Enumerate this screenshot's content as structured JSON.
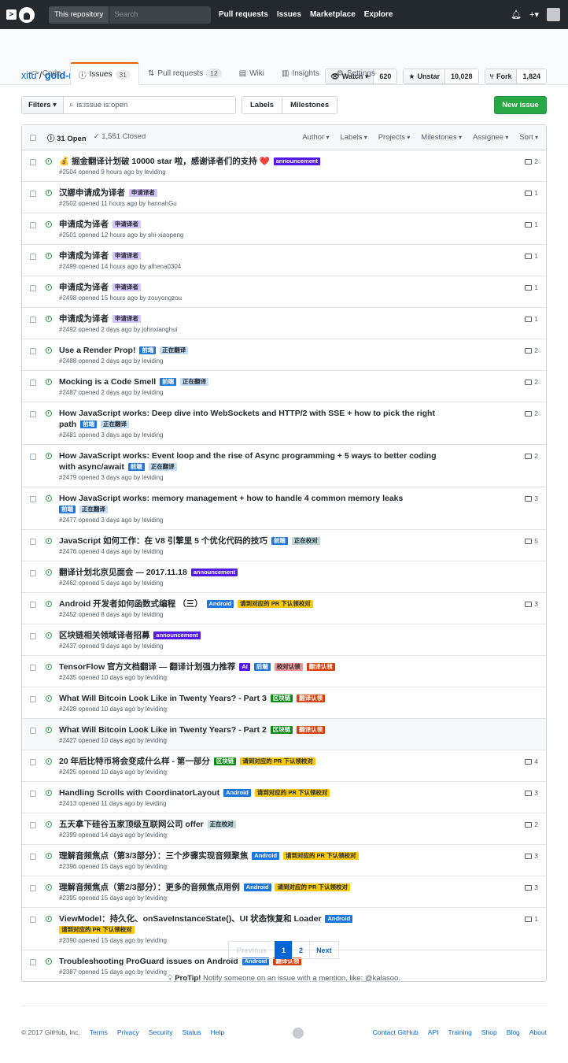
{
  "topbar": {
    "scope": "This repository",
    "search_placeholder": "Search",
    "nav": [
      "Pull requests",
      "Issues",
      "Marketplace",
      "Explore"
    ],
    "plus": "+▾"
  },
  "repo": {
    "owner": "xitu",
    "name": "gold-miner",
    "watch": "Watch ▾",
    "watch_count": "620",
    "unstar": "Unstar",
    "star_count": "10,028",
    "fork": "Fork",
    "fork_count": "1,824"
  },
  "tabs": [
    {
      "label": "Code",
      "icon": "<>"
    },
    {
      "label": "Issues",
      "count": "31"
    },
    {
      "label": "Pull requests",
      "count": "12"
    },
    {
      "label": "Wiki"
    },
    {
      "label": "Insights"
    },
    {
      "label": "Settings"
    }
  ],
  "toolbar": {
    "filters": "Filters ▾",
    "query": "is:issue is:open",
    "labels": "Labels",
    "milestones": "Milestones",
    "new_issue": "New issue"
  },
  "header": {
    "open": "31 Open",
    "closed": "1,551 Closed",
    "filters": [
      "Author",
      "Labels",
      "Projects",
      "Milestones",
      "Assignee",
      "Sort"
    ]
  },
  "label_colors": {
    "announcement": [
      "#5319e7",
      "#fff"
    ],
    "申请译者": [
      "#d4c5f9",
      "#24292e"
    ],
    "前端": [
      "#1d76db",
      "#fff"
    ],
    "正在翻译": [
      "#c5def5",
      "#24292e"
    ],
    "Android": [
      "#1d76db",
      "#fff"
    ],
    "请到对应的 PR 下认领校对": [
      "#fbca04",
      "#24292e"
    ],
    "正在校对": [
      "#bfdadc",
      "#24292e"
    ],
    "AI": [
      "#5319e7",
      "#fff"
    ],
    "后端": [
      "#1d76db",
      "#fff"
    ],
    "校对认领": [
      "#e99695",
      "#24292e"
    ],
    "翻译认领": [
      "#d93f0b",
      "#fff"
    ],
    "区块链": [
      "#0e8a16",
      "#fff"
    ]
  },
  "issues": [
    {
      "title": "💰 掘金翻译计划破 10000 star 啦，感谢译者们的支持 ❤️",
      "labels": [
        "announcement"
      ],
      "meta": "#2504 opened 9 hours ago by leviding",
      "comments": "2"
    },
    {
      "title": "汉娜申请成为译者",
      "labels": [
        "申请译者"
      ],
      "meta": "#2502 opened 11 hours ago by hannahGu",
      "comments": "1"
    },
    {
      "title": "申请成为译者",
      "labels": [
        "申请译者"
      ],
      "meta": "#2501 opened 12 hours ago by shi-xiaopeng",
      "comments": "1"
    },
    {
      "title": "申请成为译者",
      "labels": [
        "申请译者"
      ],
      "meta": "#2499 opened 14 hours ago by athena0304",
      "comments": "1"
    },
    {
      "title": "申请成为译者",
      "labels": [
        "申请译者"
      ],
      "meta": "#2498 opened 15 hours ago by zouyongzou",
      "comments": "1"
    },
    {
      "title": "申请成为译者",
      "labels": [
        "申请译者"
      ],
      "meta": "#2492 opened 2 days ago by johnxianghui",
      "comments": "1"
    },
    {
      "title": "Use a Render Prop!",
      "labels": [
        "前端",
        "正在翻译"
      ],
      "meta": "#2488 opened 2 days ago by leviding",
      "comments": "2"
    },
    {
      "title": "Mocking is a Code Smell",
      "labels": [
        "前端",
        "正在翻译"
      ],
      "meta": "#2487 opened 2 days ago by leviding",
      "comments": "2"
    },
    {
      "title": "How JavaScript works: Deep dive into WebSockets and HTTP/2 with SSE + how to pick the right path",
      "labels": [
        "前端",
        "正在翻译"
      ],
      "meta": "#2481 opened 3 days ago by leviding",
      "comments": "2"
    },
    {
      "title": "How JavaScript works: Event loop and the rise of Async programming + 5 ways to better coding with async/await",
      "labels": [
        "前端",
        "正在翻译"
      ],
      "meta": "#2479 opened 3 days ago by leviding",
      "comments": "2"
    },
    {
      "title": "How JavaScript works: memory management + how to handle 4 common memory leaks",
      "labels": [
        "前端",
        "正在翻译"
      ],
      "meta": "#2477 opened 3 days ago by leviding",
      "comments": "3",
      "labels_newline": true
    },
    {
      "title": "JavaScript 如何工作：在 V8 引擎里 5 个优化代码的技巧",
      "labels": [
        "前端",
        "正在校对"
      ],
      "meta": "#2476 opened 4 days ago by leviding",
      "comments": "5"
    },
    {
      "title": "翻译计划北京见面会 — 2017.11.18",
      "labels": [
        "announcement"
      ],
      "meta": "#2462 opened 5 days ago by leviding",
      "comments": ""
    },
    {
      "title": "Android 开发者如何函数式编程 （三）",
      "labels": [
        "Android",
        "请到对应的 PR 下认领校对"
      ],
      "meta": "#2452 opened 8 days ago by leviding",
      "comments": "3"
    },
    {
      "title": "区块链相关领域译者招募",
      "labels": [
        "announcement"
      ],
      "meta": "#2437 opened 9 days ago by leviding",
      "comments": ""
    },
    {
      "title": "TensorFlow 官方文档翻译 — 翻译计划强力推荐",
      "labels": [
        "AI",
        "后端",
        "校对认领",
        "翻译认领"
      ],
      "meta": "#2435 opened 10 days ago by leviding",
      "comments": ""
    },
    {
      "title": "What Will Bitcoin Look Like in Twenty Years? - Part 3",
      "labels": [
        "区块链",
        "翻译认领"
      ],
      "meta": "#2428 opened 10 days ago by leviding",
      "comments": ""
    },
    {
      "title": "What Will Bitcoin Look Like in Twenty Years? - Part 2",
      "labels": [
        "区块链",
        "翻译认领"
      ],
      "meta": "#2427 opened 10 days ago by leviding",
      "comments": "",
      "highlight": true
    },
    {
      "title": "20 年后比特币将会变成什么样 - 第一部分",
      "labels": [
        "区块链",
        "请到对应的 PR 下认领校对"
      ],
      "meta": "#2425 opened 10 days ago by leviding",
      "comments": "4"
    },
    {
      "title": "Handling Scrolls with CoordinatorLayout",
      "labels": [
        "Android",
        "请到对应的 PR 下认领校对"
      ],
      "meta": "#2413 opened 11 days ago by leviding",
      "comments": "3"
    },
    {
      "title": "五天拿下硅谷五家顶级互联网公司 offer",
      "labels": [
        "正在校对"
      ],
      "meta": "#2399 opened 14 days ago by leviding",
      "comments": "2"
    },
    {
      "title": "理解音频焦点（第3/3部分）：三个步骤实现音频聚焦",
      "labels": [
        "Android",
        "请到对应的 PR 下认领校对"
      ],
      "meta": "#2396 opened 15 days ago by leviding",
      "comments": "3"
    },
    {
      "title": "理解音频焦点（第2/3部分）：更多的音频焦点用例",
      "labels": [
        "Android",
        "请到对应的 PR 下认领校对"
      ],
      "meta": "#2395 opened 15 days ago by leviding",
      "comments": "3"
    },
    {
      "title": "ViewModel：持久化、onSaveInstanceState()、UI 状态恢复和 Loader",
      "labels": [
        "Android",
        "请到对应的 PR 下认领校对"
      ],
      "meta": "#2390 opened 15 days ago by leviding",
      "comments": "1",
      "split_after": 1
    },
    {
      "title": "Troubleshooting ProGuard issues on Android",
      "labels": [
        "Android",
        "翻译认领"
      ],
      "meta": "#2387 opened 15 days ago by leviding",
      "comments": ""
    }
  ],
  "pagination": {
    "previous": "Previous",
    "pages": [
      "1",
      "2"
    ],
    "next": "Next"
  },
  "protip": {
    "bold": "ProTip!",
    "text": " Notify someone on an issue with a mention, like: @kalasoo."
  },
  "footer": {
    "left": [
      "© 2017 GitHub, Inc.",
      "Terms",
      "Privacy",
      "Security",
      "Status",
      "Help"
    ],
    "right": [
      "Contact GitHub",
      "API",
      "Training",
      "Shop",
      "Blog",
      "About"
    ]
  }
}
